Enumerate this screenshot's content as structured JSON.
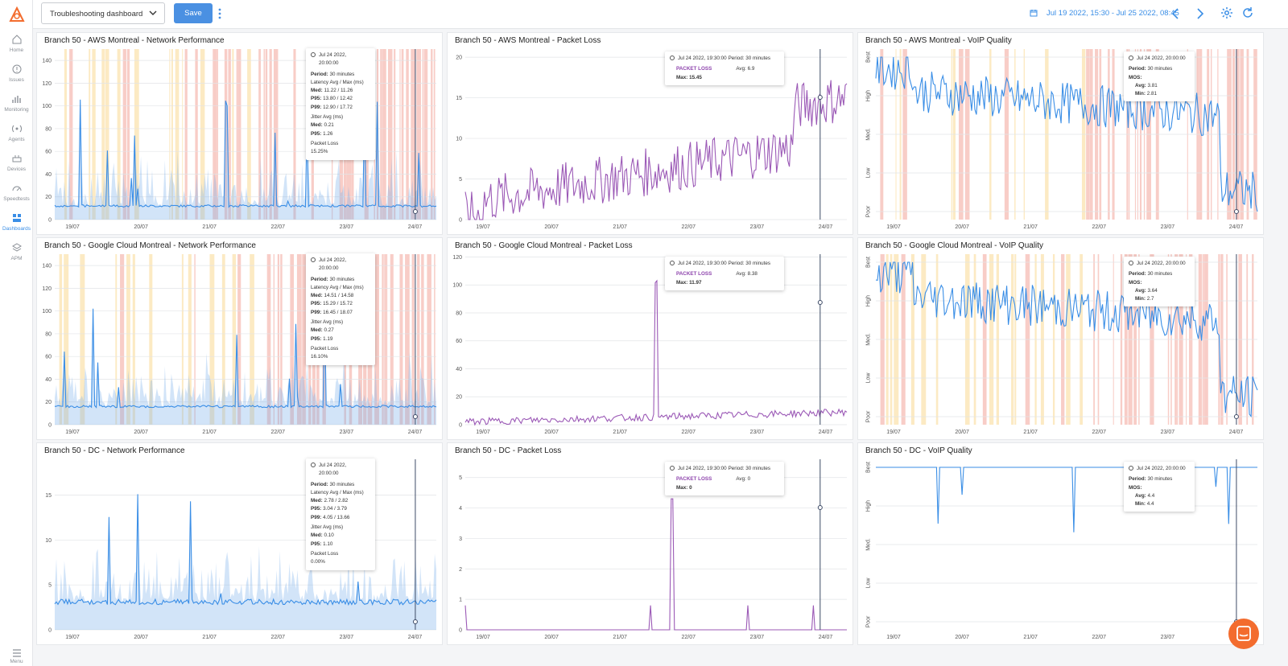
{
  "nav": {
    "items": [
      {
        "label": "Home",
        "icon": "home-icon"
      },
      {
        "label": "Issues",
        "icon": "alert-icon"
      },
      {
        "label": "Monitoring",
        "icon": "bar-chart-icon"
      },
      {
        "label": "Agents",
        "icon": "antenna-icon"
      },
      {
        "label": "Devices",
        "icon": "router-icon"
      },
      {
        "label": "Speedtests",
        "icon": "speedometer-icon"
      },
      {
        "label": "Dashboards",
        "icon": "dashboard-icon",
        "active": true
      },
      {
        "label": "APM",
        "icon": "layers-icon"
      }
    ],
    "menu_label": "Menu"
  },
  "toolbar": {
    "dashboard_selected": "Troubleshooting dashboard",
    "save_label": "Save",
    "date_range": "Jul 19 2022, 15:30 - Jul 25 2022, 08:45"
  },
  "colors": {
    "accent": "#4a90e2",
    "latency": "#3a8ee6",
    "packet_loss": "#9b59b6",
    "bad": "#f7c4bd",
    "warn": "#fbe6b8"
  },
  "x_ticks": [
    "19/07",
    "20/07",
    "21/07",
    "22/07",
    "23/07",
    "24/07"
  ],
  "panels": [
    {
      "title": "Branch 50 - AWS Montreal - Network Performance",
      "kind": "net",
      "yticks": [
        "0",
        "20",
        "40",
        "60",
        "80",
        "100",
        "120",
        "140"
      ],
      "ymax": 150,
      "tooltip": {
        "date": "Jul 24 2022,",
        "time": "20:00:00",
        "period": "30 minutes",
        "lat_header": "Latency Avg / Max (ms)",
        "med": "11.22 / 11.26",
        "p95": "13.80 / 12.42",
        "p99": "12.90 / 17.72",
        "jit_header": "Jitter Avg (ms)",
        "jmed": "0.21",
        "jp95": "1.26",
        "pl_header": "Packet Loss",
        "pl": "15.25%"
      }
    },
    {
      "title": "Branch 50 - AWS Montreal - Packet Loss",
      "kind": "pl",
      "yticks": [
        "0",
        "5",
        "10",
        "15",
        "20"
      ],
      "ymax": 21,
      "tooltip": {
        "date": "Jul 24 2022, 19:30:00",
        "period": "Period: 30 minutes",
        "label": "PACKET LOSS",
        "avg": "Avg: 6.9",
        "max": "Max: 15.45"
      }
    },
    {
      "title": "Branch 50 - AWS Montreal - VoIP Quality",
      "kind": "voip",
      "yticks": [
        "Poor",
        "Low",
        "Med.",
        "High",
        "Best"
      ],
      "tooltip": {
        "date": "Jul 24 2022, 20:00:00",
        "period": "30 minutes",
        "mos": "MOS:",
        "avg": "3.81",
        "min": "2.81"
      }
    },
    {
      "title": "Branch 50 - Google Cloud Montreal - Network Performance",
      "kind": "net",
      "yticks": [
        "0",
        "20",
        "40",
        "60",
        "80",
        "100",
        "120",
        "140"
      ],
      "ymax": 150,
      "tooltip": {
        "date": "Jul 24 2022,",
        "time": "20:00:00",
        "period": "30 minutes",
        "lat_header": "Latency Avg / Max (ms)",
        "med": "14.51 / 14.58",
        "p95": "15.29 / 15.72",
        "p99": "16.45 / 18.07",
        "jit_header": "Jitter Avg (ms)",
        "jmed": "0.27",
        "jp95": "1.19",
        "pl_header": "Packet Loss",
        "pl": "16.10%"
      }
    },
    {
      "title": "Branch 50 - Google Cloud Montreal - Packet Loss",
      "kind": "pl",
      "yticks": [
        "0",
        "20",
        "40",
        "60",
        "80",
        "100",
        "120"
      ],
      "ymax": 122,
      "tooltip": {
        "date": "Jul 24 2022, 19:30:00",
        "period": "Period: 30 minutes",
        "label": "PACKET LOSS",
        "avg": "Avg: 8.38",
        "max": "Max: 11.97"
      }
    },
    {
      "title": "Branch 50 - Google Cloud Montreal - VoIP Quality",
      "kind": "voip",
      "yticks": [
        "Poor",
        "Low",
        "Med.",
        "High",
        "Best"
      ],
      "tooltip": {
        "date": "Jul 24 2022, 20:00:00",
        "period": "30 minutes",
        "mos": "MOS:",
        "avg": "3.64",
        "min": "2.7"
      }
    },
    {
      "title": "Branch 50 - DC - Network Performance",
      "kind": "net",
      "yticks": [
        "0",
        "5",
        "10",
        "15"
      ],
      "ymax": 19,
      "tooltip": {
        "date": "Jul 24 2022,",
        "time": "20:00:00",
        "period": "30 minutes",
        "lat_header": "Latency Avg / Max (ms)",
        "med": "2.78 / 2.82",
        "p95": "3.04 / 3.79",
        "p99": "4.05 / 13.66",
        "jit_header": "Jitter Avg (ms)",
        "jmed": "0.10",
        "jp95": "1.10",
        "pl_header": "Packet Loss",
        "pl": "0.00%"
      }
    },
    {
      "title": "Branch 50 - DC - Packet Loss",
      "kind": "pl",
      "yticks": [
        "0",
        "1",
        "2",
        "3",
        "4",
        "5"
      ],
      "ymax": 5.6,
      "tooltip": {
        "date": "Jul 24 2022, 19:30:00",
        "period": "Period: 30 minutes",
        "label": "PACKET LOSS",
        "avg": "Avg: 0",
        "max": "Max: 0"
      }
    },
    {
      "title": "Branch 50 - DC - VoIP Quality",
      "kind": "voip",
      "yticks": [
        "Poor",
        "Low",
        "Med.",
        "High",
        "Best"
      ],
      "tooltip": {
        "date": "Jul 24 2022, 20:00:00",
        "period": "30 minutes",
        "mos": "MOS:",
        "avg": "4.4",
        "min": "4.4"
      }
    }
  ]
}
